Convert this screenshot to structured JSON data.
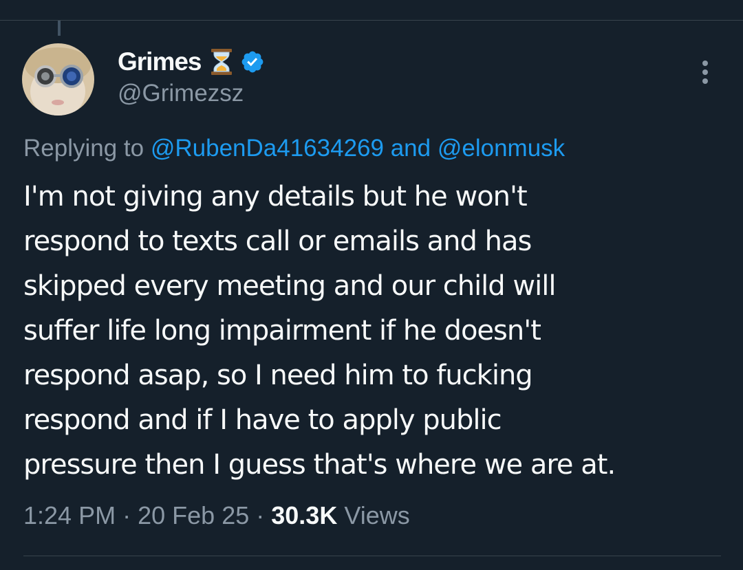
{
  "tweet": {
    "author": {
      "display_name": "Grimes",
      "handle": "@Grimezsz",
      "name_emoji": "hourglass-icon",
      "verified_icon": "verified-badge-icon"
    },
    "reply_context": {
      "prefix": "Replying to",
      "mention_1": "@RubenDa41634269",
      "joiner": "and",
      "mention_2": "@elonmusk"
    },
    "text_lines": [
      "I'm not giving any details but he won't",
      "respond to texts call or emails and has",
      "skipped every meeting and our child will",
      "suffer life long impairment if he doesn't",
      "respond asap, so I need him to fucking",
      "respond and if I have to apply public",
      "pressure then I guess that's where we are at."
    ],
    "meta": {
      "time": "1:24 PM",
      "separator": "·",
      "date": "20 Feb 25",
      "views_count": "30.3K",
      "views_label": "Views"
    }
  },
  "colors": {
    "background": "#15202b",
    "text": "#f7f9f9",
    "secondary_text": "#8b98a5",
    "link": "#1d9bf0",
    "verified": "#1d9bf0",
    "divider": "#38444d"
  }
}
